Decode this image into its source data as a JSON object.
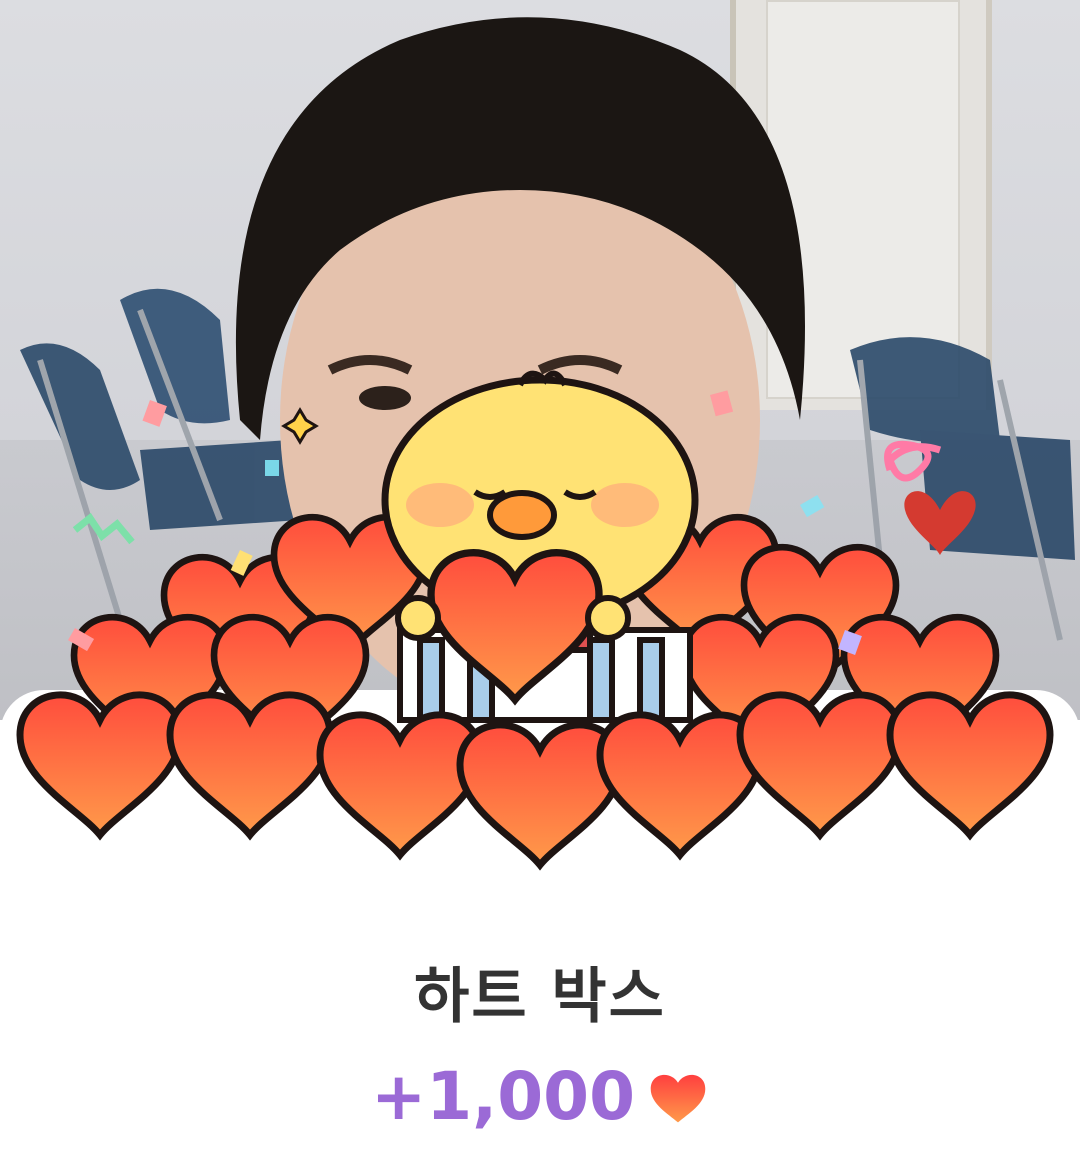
{
  "reward": {
    "title": "하트 박스",
    "amount": "+1,000",
    "currency_icon": "heart-icon"
  },
  "colors": {
    "title": "#333333",
    "amount": "#9b6ad6",
    "heart": "#ff5a3c"
  }
}
